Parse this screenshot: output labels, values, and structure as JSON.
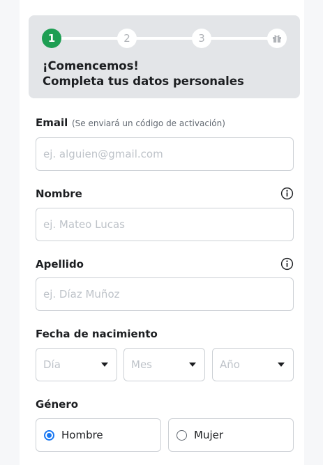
{
  "stepper": {
    "steps": [
      {
        "label": "1",
        "active": true
      },
      {
        "label": "2",
        "active": false
      },
      {
        "label": "3",
        "active": false
      }
    ],
    "final_icon": "gift-icon",
    "title_line1": "¡Comencemos!",
    "title_line2": "Completa tus datos personales",
    "active_color": "#1e9e53"
  },
  "form": {
    "email": {
      "label": "Email",
      "hint": "(Se enviará un código de activación)",
      "placeholder": "ej. alguien@gmail.com",
      "value": ""
    },
    "first_name": {
      "label": "Nombre",
      "placeholder": "ej. Mateo Lucas",
      "value": "",
      "icon": "info-icon"
    },
    "last_name": {
      "label": "Apellido",
      "placeholder": "ej. Díaz Muñoz",
      "value": "",
      "icon": "info-icon"
    },
    "birthdate": {
      "label": "Fecha de nacimiento",
      "day": "Día",
      "month": "Mes",
      "year": "Año"
    },
    "gender": {
      "label": "Género",
      "options": [
        {
          "label": "Hombre",
          "selected": true
        },
        {
          "label": "Mujer",
          "selected": false
        }
      ],
      "accent_color": "#1877f2"
    }
  }
}
